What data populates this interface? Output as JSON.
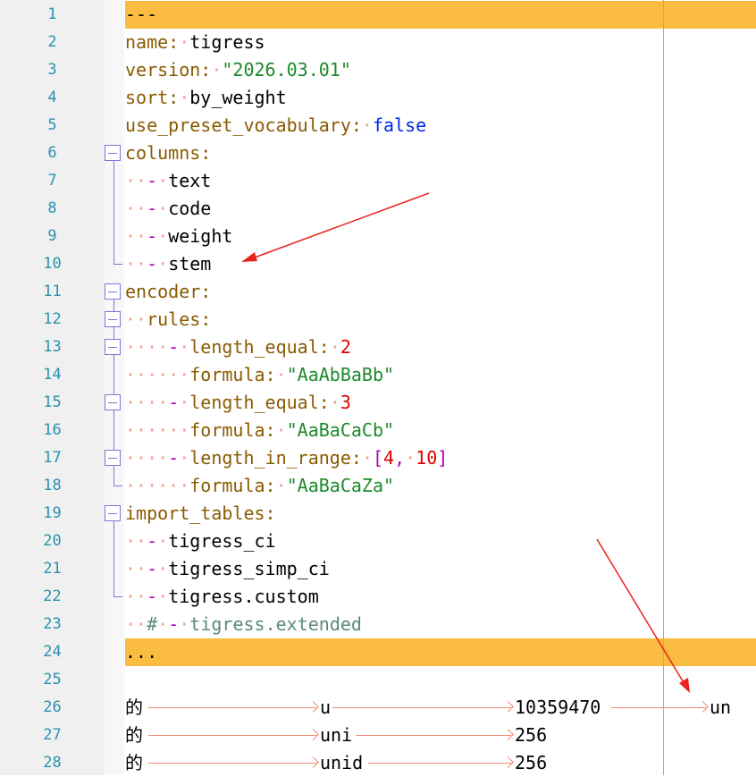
{
  "line_numbers": [
    "1",
    "2",
    "3",
    "4",
    "5",
    "6",
    "7",
    "8",
    "9",
    "10",
    "11",
    "12",
    "13",
    "14",
    "15",
    "16",
    "17",
    "18",
    "19",
    "20",
    "21",
    "22",
    "23",
    "24",
    "25",
    "26",
    "27",
    "28"
  ],
  "yaml": {
    "doc_start": "---",
    "name_key": "name",
    "name_value": "tigress",
    "version_key": "version",
    "version_value": "\"2026.03.01\"",
    "sort_key": "sort",
    "sort_value": "by_weight",
    "preset_key": "use_preset_vocabulary",
    "preset_value": "false",
    "columns_key": "columns",
    "columns": [
      "text",
      "code",
      "weight",
      "stem"
    ],
    "encoder_key": "encoder",
    "rules_key": "rules",
    "rules": [
      {
        "cond_key": "length_equal",
        "cond_value": "2",
        "formula_key": "formula",
        "formula_value": "\"AaAbBaBb\""
      },
      {
        "cond_key": "length_equal",
        "cond_value": "3",
        "formula_key": "formula",
        "formula_value": "\"AaBaCaCb\""
      },
      {
        "cond_key": "length_in_range",
        "range_open": "[",
        "range_a": "4",
        "range_sep": ",",
        "range_b": "10",
        "range_close": "]",
        "formula_key": "formula",
        "formula_value": "\"AaBaCaZa\""
      }
    ],
    "import_key": "import_tables",
    "imports": [
      "tigress_ci",
      "tigress_simp_ci",
      "tigress.custom"
    ],
    "comment_hash": "#",
    "comment_text": "tigress.extended",
    "doc_end": "..."
  },
  "table_rows": [
    {
      "char": "的",
      "code": "u",
      "weight": "10359470",
      "stem": "un"
    },
    {
      "char": "的",
      "code": "uni",
      "weight": "256",
      "stem": ""
    },
    {
      "char": "的",
      "code": "unid",
      "weight": "256",
      "stem": ""
    }
  ],
  "colors": {
    "highlight": "#fbbc42",
    "edge": "#f3a021",
    "line_number": "#2b91af",
    "key": "#8a5a00",
    "string": "#1c8a2a",
    "number": "#e00000",
    "boolean": "#0026e8",
    "annotation_arrow": "#e8231a"
  }
}
